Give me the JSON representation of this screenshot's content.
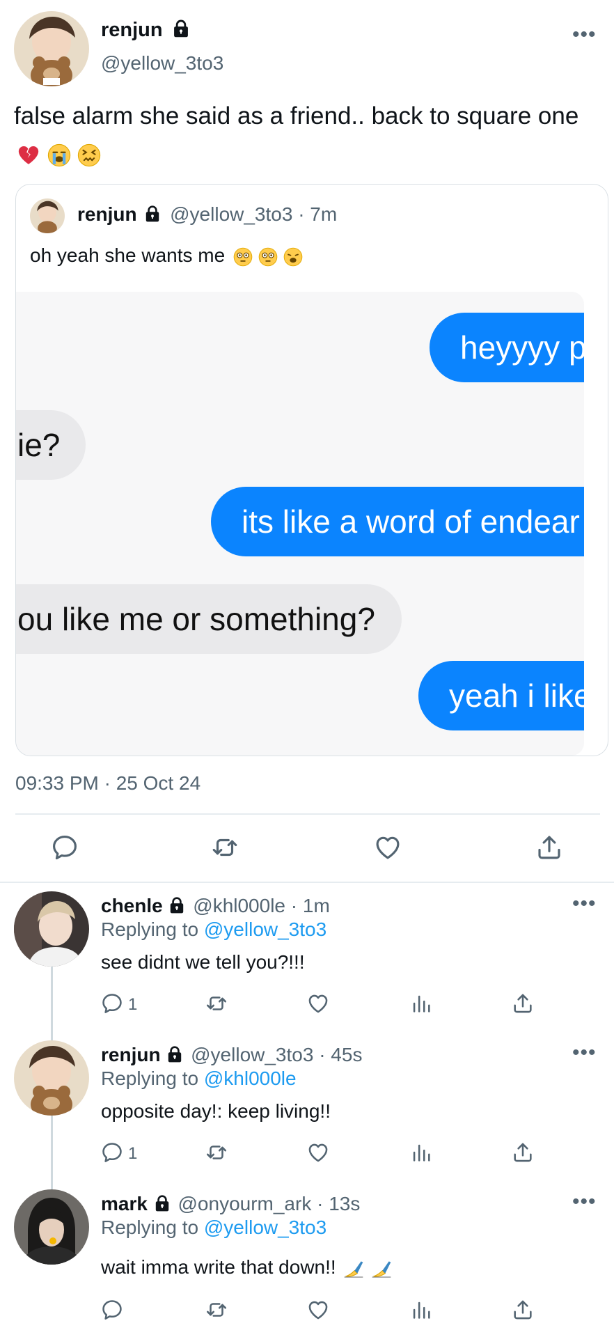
{
  "main_tweet": {
    "name": "renjun",
    "handle": "@yellow_3to3",
    "text": "false alarm she said as a friend.. back to square one",
    "timestamp": "09:33 PM · 25 Oct 24"
  },
  "quoted_tweet": {
    "name": "renjun",
    "handle_time": "@yellow_3to3 · 7m",
    "text": "oh yeah she wants me",
    "bubbles": [
      {
        "side": "right",
        "text": "heyyyy p"
      },
      {
        "side": "left",
        "text": "ie?"
      },
      {
        "side": "right",
        "text": "its like a word of endear"
      },
      {
        "side": "left",
        "text": "ou like me or something?"
      },
      {
        "side": "right",
        "text": "yeah i like"
      }
    ]
  },
  "replies": [
    {
      "name": "chenle",
      "handle_time": "@khl000le · 1m",
      "replying_prefix": "Replying to",
      "replying_to": "@yellow_3to3",
      "text": "see didnt we tell you?!!!",
      "reply_count": "1"
    },
    {
      "name": "renjun",
      "handle_time": "@yellow_3to3 · 45s",
      "replying_prefix": "Replying to",
      "replying_to": "@khl000le",
      "text": "opposite day!: keep living!!",
      "reply_count": "1"
    },
    {
      "name": "mark",
      "handle_time": "@onyourm_ark · 13s",
      "replying_prefix": "Replying to",
      "replying_to": "@yellow_3to3",
      "text": "wait imma write that down!!",
      "reply_count": ""
    }
  ],
  "icons": {
    "action_bar": [
      "reply-icon",
      "retweet-icon",
      "like-icon",
      "share-icon"
    ],
    "reply_actions": [
      "reply-icon",
      "retweet-icon",
      "like-icon",
      "analytics-icon",
      "share-icon"
    ],
    "emojis_main": [
      "broken-heart-emoji",
      "loudly-crying-emoji",
      "confounded-emoji"
    ],
    "emojis_quote": [
      "flushed-emoji",
      "flushed-emoji",
      "weary-emoji"
    ],
    "emojis_mark": [
      "writing-hand-emoji",
      "writing-hand-emoji"
    ]
  },
  "colors": {
    "link": "#1d9bf0",
    "bubble_blue": "#0b84fe",
    "bubble_gray": "#e9e9eb",
    "muted": "#536471"
  }
}
